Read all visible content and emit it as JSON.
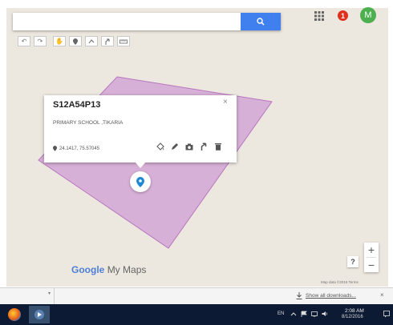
{
  "search": {
    "placeholder": "",
    "value": ""
  },
  "toolbar": {
    "tools": [
      "undo-icon",
      "redo-icon",
      "hand-icon",
      "pin-icon",
      "draw-line-icon",
      "directions-icon",
      "ruler-icon"
    ]
  },
  "header": {
    "notification_count": "1",
    "avatar_letter": "M"
  },
  "info_card": {
    "title": "S12A54P13",
    "description": "PRIMARY SCHOOL ,TIKARIA",
    "coordinates": "24.1417, 75.57045",
    "close": "×"
  },
  "map": {
    "polygon_fill": "#d4a6d7",
    "polygon_stroke": "#b877be",
    "marker_color": "#1e88d6",
    "logo_brand": "Google",
    "logo_product": "My Maps",
    "zoom_in": "+",
    "zoom_out": "−",
    "help": "?",
    "attribution": "Map data ©2016   Terms"
  },
  "download_bar": {
    "link": "Show all downloads...",
    "close": "×"
  },
  "taskbar": {
    "language": "EN",
    "time": "2:08 AM",
    "date": "8/12/2016"
  },
  "colors": {
    "accent": "#3f80ee",
    "notification": "#e0301e",
    "avatar": "#4caf50",
    "taskbar": "#0c1a33"
  }
}
